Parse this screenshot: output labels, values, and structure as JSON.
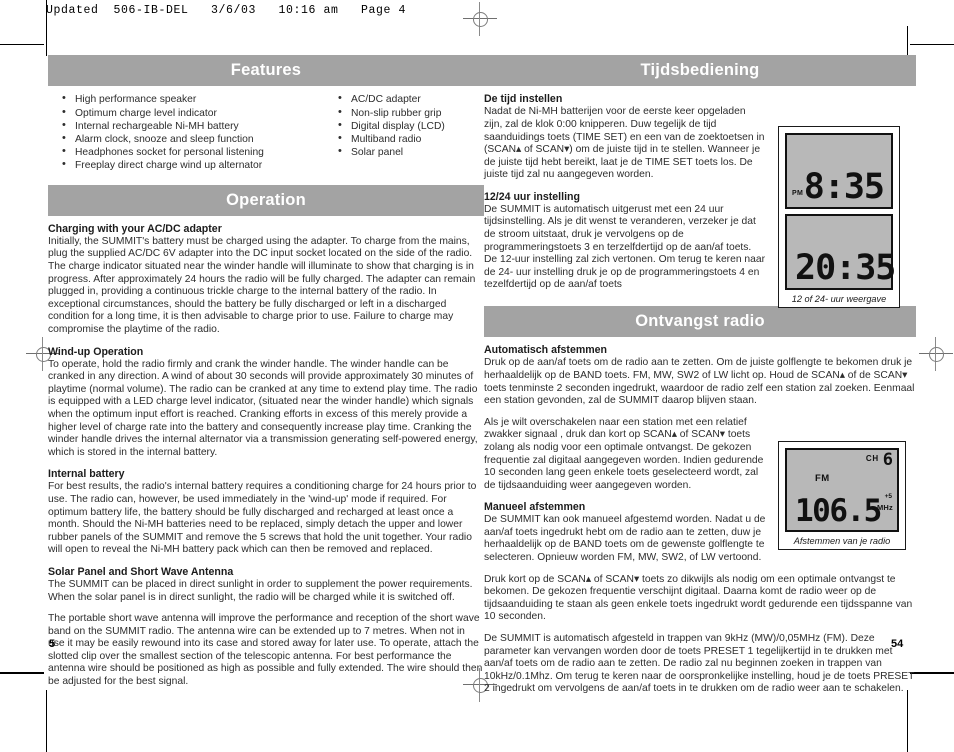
{
  "print_header": "Updated  506-IB-DEL   3/6/03   10:16 am   Page 4",
  "page_numbers": {
    "left": "5",
    "right": "54"
  },
  "left_column": {
    "features": {
      "bar_title": "Features",
      "list_col1": [
        "High performance speaker",
        "Optimum charge level indicator",
        "Internal rechargeable Ni-MH battery",
        "Alarm clock, snooze and sleep function",
        "Headphones socket for personal listening",
        "Freeplay direct charge wind up alternator"
      ],
      "list_col2": [
        "AC/DC adapter",
        "Non-slip rubber grip",
        "Digital display (LCD)",
        "Multiband radio",
        "Solar panel"
      ]
    },
    "operation": {
      "bar_title": "Operation",
      "blocks": [
        {
          "heading": "Charging with your AC/DC adapter",
          "paragraphs": [
            "Initially, the SUMMIT's battery must be charged using the adapter. To charge from the mains, plug the supplied AC/DC 6V adapter into the DC input socket located on the side of the radio. The charge indicator situated near the winder handle will illuminate to show that charging is in progress. After approximately 24 hours the radio will be fully charged. The adapter can remain plugged in, providing a continuous trickle charge to the internal battery of the radio. In exceptional circumstances, should the battery be fully discharged or left in a discharged condition for a long time, it is then advisable to charge prior to use. Failure to charge may compromise the playtime of the radio."
          ]
        },
        {
          "heading": "Wind-up Operation",
          "paragraphs": [
            "To operate, hold the radio firmly and crank the winder handle. The winder handle can be cranked in any direction. A wind of about 30 seconds will provide approximately 30 minutes of playtime (normal volume). The radio can be cranked at any time to extend play time. The radio is equipped with a LED charge level indicator, (situated near the winder handle) which signals when the optimum input effort is reached. Cranking efforts in excess of this merely provide a higher level of charge rate into the battery and consequently increase play time. Cranking the winder handle drives the internal alternator via a transmission generating self-powered energy, which is stored in the internal battery."
          ]
        },
        {
          "heading": "Internal battery",
          "paragraphs": [
            "For best results, the radio's internal battery requires a conditioning charge for 24 hours prior to use. The radio can, however, be used immediately in the 'wind-up' mode if required. For optimum battery life, the battery should be fully discharged and recharged at least once a month. Should the Ni-MH batteries need to be replaced, simply detach the upper and lower rubber panels of the SUMMIT and remove the 5 screws that hold the unit together. Your radio will open to reveal the Ni-MH battery pack which can then be removed and replaced."
          ]
        },
        {
          "heading": "Solar Panel and Short Wave Antenna",
          "paragraphs": [
            "The SUMMIT can be placed in direct sunlight in order to supplement the power requirements. When the solar panel is in direct sunlight, the radio will be charged while it is switched off.",
            "The portable short wave antenna will improve the performance and reception of the short wave band on the SUMMIT radio. The antenna wire can be extended up to 7 metres. When not in use it may be easily rewound into its case and stored away for later use. To operate, attach the slotted clip over the smallest section of the telescopic antenna. For best performance the antenna wire should be positioned as high as possible and fully extended. The wire should then be adjusted for the best signal."
          ]
        }
      ]
    }
  },
  "right_column": {
    "tijdsbediening": {
      "bar_title": "Tijdsbediening",
      "blocks": [
        {
          "heading": "De tijd instellen",
          "paragraphs": [
            "Nadat de Ni-MH batterijen voor de eerste keer opgeladen zijn, zal de klok 0:00 knipperen. Duw tegelijk de tijd saanduidings toets (TIME SET) en een van de zoektoetsen in (SCAN▴ of SCAN▾) om de juiste tijd in te stellen. Wanneer je de juiste tijd hebt bereikt, laat je de TIME SET toets los. De juiste tijd zal nu aangegeven worden."
          ]
        },
        {
          "heading": "12/24 uur instelling",
          "paragraphs": [
            "De SUMMIT is automatisch uitgerust met een 24 uur tijdsinstelling. Als je dit wenst te veranderen, verzeker je dat de stroom uitstaat, druk je vervolgens op de programmeringstoets 3 en terzelfdertijd op de aan/af toets. De 12-uur instelling zal zich vertonen. Om terug te keren naar de 24- uur instelling druk je op de programmeringstoets 4 en tezelfdertijd op de aan/af toets"
          ]
        }
      ],
      "figure": {
        "caption": "12 of 24- uur weergave",
        "display_12h": {
          "pm_label": "PM",
          "time": "8:35"
        },
        "display_24h": {
          "time": "20:35"
        }
      }
    },
    "ontvangst": {
      "bar_title": "Ontvangst radio",
      "blocks": [
        {
          "heading": "Automatisch afstemmen",
          "paragraphs": [
            "Druk op de aan/af toets om de radio aan te zetten. Om de juiste golflengte te bekomen druk je herhaaldelijk op de BAND toets. FM, MW, SW2 of LW licht op. Houd de SCAN▴ of de SCAN▾ toets tenminste 2 seconden ingedrukt, waardoor de radio zelf een station zal zoeken. Eenmaal een station gevonden, zal de SUMMIT daarop blijven staan."
          ]
        },
        {
          "heading": "",
          "paragraphs": [
            "Als je wilt overschakelen naar een station met een relatief zwakker signaal , druk dan kort op SCAN▴ of SCAN▾ toets zolang als nodig voor een optimale ontvangst. De gekozen frequentie zal digitaal aangegeven worden. Indien gedurende 10 seconden lang geen enkele toets geselecteerd wordt, zal de tijdsaanduiding weer aangegeven worden."
          ]
        },
        {
          "heading": "Manueel afstemmen",
          "paragraphs": [
            "De SUMMIT kan ook manueel afgestemd worden. Nadat u de aan/af toets ingedrukt hebt om de radio aan te zetten, duw je herhaaldelijk op de BAND toets om de gewenste golflengte te selecteren. Opnieuw worden FM, MW, SW2, of LW vertoond."
          ]
        }
      ],
      "tail_paragraphs": [
        "Druk kort op de SCAN▴ of SCAN▾ toets zo dikwijls als nodig om een optimale ontvangst te bekomen. De gekozen frequentie verschijnt digitaal. Daarna komt de radio weer op de tijdsaanduiding te staan als geen enkele toets ingedrukt wordt gedurende een tijdsspanne van 10 seconden.",
        "De SUMMIT is automatisch afgesteld in trappen van 9kHz (MW)/0,05MHz (FM). Deze parameter kan vervangen worden door de toets PRESET 1 tegelijkertijd in te drukken met aan/af toets om de radio aan te zetten. De radio zal nu beginnen zoeken in trappen van 10kHz/0.1Mhz. Om terug te keren naar de oorspronkelijke instelling, houd je de toets PRESET 2 ingedrukt om vervolgens de aan/af toets in te drukken om de radio weer aan te schakelen."
      ],
      "figure": {
        "caption": "Afstemmen van je radio",
        "display": {
          "ch_label": "CH",
          "ch_value": "6",
          "band": "FM",
          "frequency": "106.5",
          "plus_label": "+5",
          "unit": "MHz"
        }
      }
    }
  }
}
